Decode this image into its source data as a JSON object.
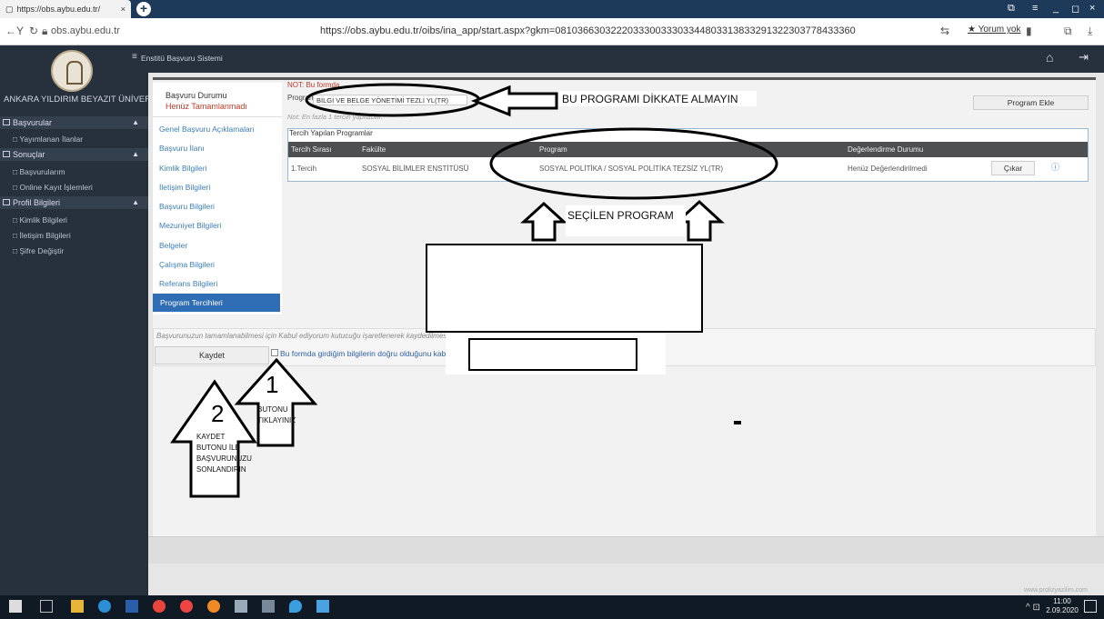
{
  "browser": {
    "tab_title": "https://obs.aybu.edu.tr/",
    "tab_close": "×",
    "new_tab": "+",
    "address_short": "obs.aybu.edu.tr",
    "address_full": "https://obs.aybu.edu.tr/oibs/ina_app/start.aspx?gkm=0810366303222033300333033448033138332913223037784333​60",
    "comments": "★ Yorum yok"
  },
  "sidebar": {
    "university": "ANKARA YILDIRIM BEYAZIT ÜNİVERSİTESİ",
    "sections": [
      {
        "label": "Başvurular",
        "items": [
          "Yayımlanan İlanlar"
        ]
      },
      {
        "label": "Sonuçlar",
        "items": [
          "Başvurularım",
          "Online Kayıt İşlemleri"
        ]
      },
      {
        "label": "Profil Bilgileri",
        "items": [
          "Kimlik Bilgileri",
          "İletişim Bilgileri",
          "Şifre Değiştir"
        ]
      }
    ]
  },
  "topbar": {
    "title": "Enstitü Başvuru Sistemi"
  },
  "steps": {
    "status_title": "Başvuru Durumu",
    "status_value": "Henüz Tamamlanmadı",
    "items": [
      "Genel Başvuru Açıklamaları",
      "Başvuru İlanı",
      "Kimlik Bilgileri",
      "İletişim Bilgileri",
      "Başvuru Bilgileri",
      "Mezuniyet Bilgileri",
      "Belgeler",
      "Çalışma Bilgileri",
      "Referans Bilgileri"
    ],
    "active": "Program Tercihleri"
  },
  "main": {
    "warning": "NOT: Bu formda ...",
    "program_label": "Program",
    "program_value": "BİLGİ VE BELGE YÖNETİMİ TEZLİ YL(TR)",
    "add_program": "Program Ekle",
    "note": "Not: En fazla 1 tercih yapılabilir.",
    "table_title": "Tercih Yapılan Programlar",
    "columns": [
      "Tercih Sırası",
      "Fakülte",
      "Program",
      "Değerlendirme Durumu"
    ],
    "row": {
      "order": "1.Tercih",
      "faculty": "SOSYAL BİLİMLER ENSTİTÜSÜ",
      "program": "SOSYAL POLİTİKA / SOSYAL POLİTİKA TEZSİZ YL(TR)",
      "status": "Henüz Değerlendirilmedi",
      "remove": "Çıkar"
    },
    "confirm_text": "Başvurunuzun tamamlanabilmesi için Kabul ediyorum kutucuğu işaretlenerek kaydedilmesi",
    "save": "Kaydet",
    "checkbox_label": "Bu formda girdiğim bilgilerin doğru olduğunu kabul ediyorum",
    "credit": "www.prolizyazilim.com"
  },
  "annotations": {
    "ignore": "BU PROGRAMI DİKKATE ALMAYIN",
    "selected": "SEÇİLEN PROGRAM",
    "num1": "1",
    "num1_text": "BUTONU TIKLAYINIZ",
    "num2": "2",
    "num2_text": "KAYDET BUTONU İLE BAŞVURUNUZU SONLANDIRIN"
  },
  "taskbar": {
    "time": "11:00",
    "date": "2.09.2020"
  },
  "colors": {
    "sidebar": "#27313e",
    "active_step": "#2f6db5",
    "table_head": "#4d4f51",
    "link": "#3a7dbb",
    "warning": "#c0392b"
  }
}
